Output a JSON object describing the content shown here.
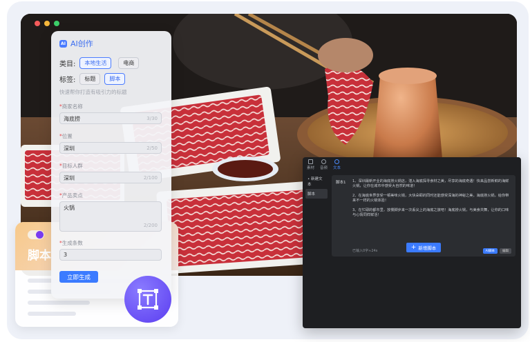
{
  "window_dots": [
    "#f45b5b",
    "#f5b73b",
    "#3ccf6a"
  ],
  "ai_panel": {
    "title": "AI创作",
    "category_label": "类目:",
    "categories": [
      "本地生活",
      "电商"
    ],
    "tag_label": "标签:",
    "tags": [
      "标题",
      "脚本"
    ],
    "hint": "快速帮你打造有吸引力的标题",
    "fields": [
      {
        "label": "商家名称",
        "value": "海底捞",
        "count": "3/30"
      },
      {
        "label": "位置",
        "value": "深圳",
        "count": "2/50"
      },
      {
        "label": "目标人群",
        "value": "深圳",
        "count": "2/100"
      },
      {
        "label": "产品卖点",
        "value": "火锅",
        "count": "2/200"
      },
      {
        "label": "生成条数",
        "value": "3",
        "count": ""
      }
    ],
    "generate_button": "立即生成"
  },
  "script_card": {
    "title": "脚本"
  },
  "editor": {
    "tabs": [
      "素材",
      "音频",
      "文本"
    ],
    "sidebar": [
      "新建文本",
      "脚本"
    ],
    "script_label": "脚本1",
    "paragraphs": [
      "1、深圳最新开业的海底捞火锅店，湛入海底探寻食材之美，尽享的海底奇遇！快来品尝新鲜的海鲜火锅，让你在城市中感受大自然的味道！",
      "2、在海底世界享受一顿美味火锅，大快朵颐的同时还能感受深海的神秘之美，海底捞火锅，给你带来不一样的火锅体验！",
      "3、在忙碌的都市里，放慢脚步来一次丢尖上的海底之旅吧！海底捞火锅，与美食共舞，让你的口味与心情同样鲜活！"
    ],
    "meta": "已输入0字≈24s",
    "apply_button": "AI脚本",
    "edit_button": "编辑",
    "add_button": "新增脚本"
  },
  "icons": {
    "ai_logo": "ai-logo-icon",
    "text_tool": "text-frame-icon",
    "plus": "plus-icon"
  }
}
